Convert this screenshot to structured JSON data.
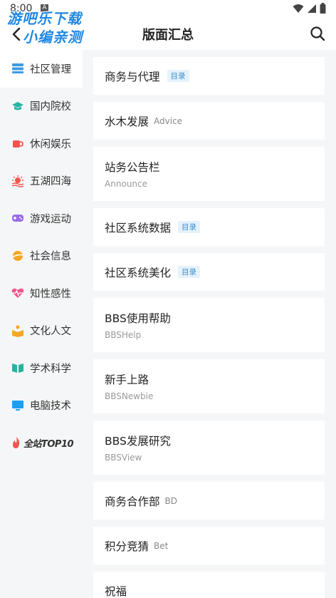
{
  "status": {
    "time": "8:00",
    "notify": "A"
  },
  "watermark": {
    "line1": "游吧乐下载",
    "line2": "小编亲测"
  },
  "header": {
    "title": "版面汇总"
  },
  "sidebar": {
    "items": [
      {
        "label": "社区管理",
        "icon": "community-icon",
        "color": "#3b9be3"
      },
      {
        "label": "国内院校",
        "icon": "graduation-cap-icon",
        "color": "#27b3a2"
      },
      {
        "label": "休闲娱乐",
        "icon": "coffee-cup-icon",
        "color": "#f0564f"
      },
      {
        "label": "五湖四海",
        "icon": "sun-waves-icon",
        "color": "#f0564f"
      },
      {
        "label": "游戏运动",
        "icon": "gamepad-icon",
        "color": "#9b6ee8"
      },
      {
        "label": "社会信息",
        "icon": "globe-icon",
        "color": "#f5a623"
      },
      {
        "label": "知性感性",
        "icon": "heart-pulse-icon",
        "color": "#f0568a"
      },
      {
        "label": "文化人文",
        "icon": "reading-person-icon",
        "color": "#f5a623"
      },
      {
        "label": "学术科学",
        "icon": "open-book-icon",
        "color": "#27b3a2"
      },
      {
        "label": "电脑技术",
        "icon": "monitor-icon",
        "color": "#1e9ff2"
      }
    ],
    "top10": "全站TOP10",
    "top10_color": "#f0564f"
  },
  "boards": [
    {
      "name": "商务与代理",
      "eng": "",
      "badge": "目录"
    },
    {
      "name": "水木发展",
      "eng_inline": "Advice"
    },
    {
      "name": "站务公告栏",
      "eng": "Announce"
    },
    {
      "name": "社区系统数据",
      "badge": "目录"
    },
    {
      "name": "社区系统美化",
      "badge": "目录"
    },
    {
      "name": "BBS使用帮助",
      "eng": "BBSHelp"
    },
    {
      "name": "新手上路",
      "eng": "BBSNewbie"
    },
    {
      "name": "BBS发展研究",
      "eng": "BBSView"
    },
    {
      "name": "商务合作部",
      "eng_inline": "BD"
    },
    {
      "name": "积分竞猜",
      "eng_inline": "Bet"
    },
    {
      "name": "祝福"
    }
  ]
}
